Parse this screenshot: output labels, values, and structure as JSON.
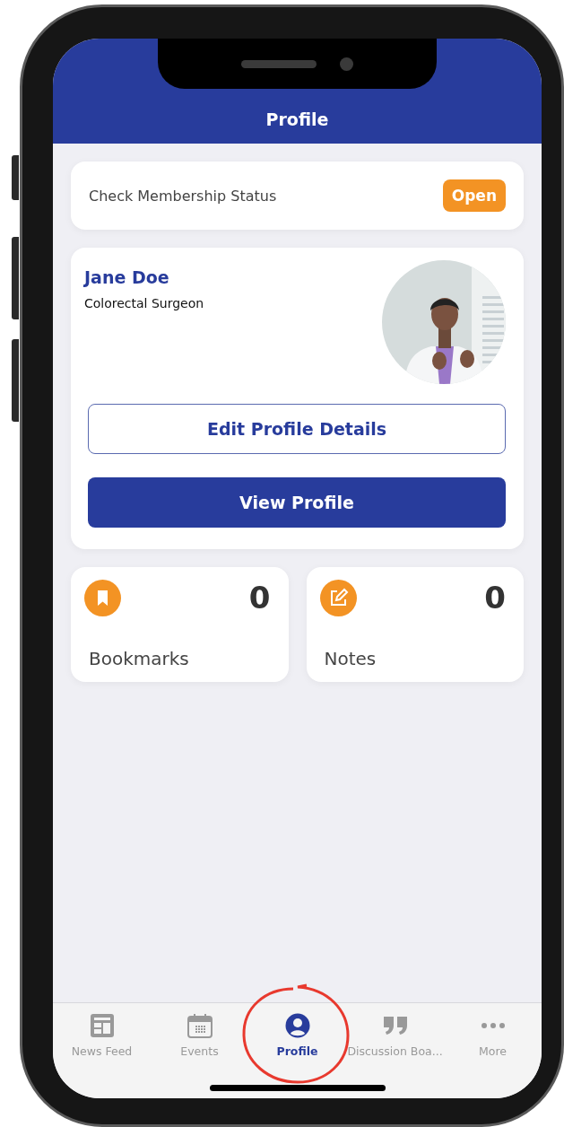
{
  "header": {
    "title": "Profile"
  },
  "membership": {
    "label": "Check Membership Status",
    "button": "Open"
  },
  "profile": {
    "name": "Jane Doe",
    "role": "Colorectal Surgeon",
    "buttons": [
      {
        "label": "Edit Profile Details",
        "kind": "outline"
      },
      {
        "label": "View Profile",
        "kind": "filled"
      }
    ]
  },
  "stats": [
    {
      "kind": "bookmark",
      "count": "0",
      "label": "Bookmarks"
    },
    {
      "kind": "note",
      "count": "0",
      "label": "Notes"
    }
  ],
  "tabs": [
    {
      "kind": "news",
      "label": "News Feed",
      "selected": false
    },
    {
      "kind": "events",
      "label": "Events",
      "selected": false
    },
    {
      "kind": "profile",
      "label": "Profile",
      "selected": true
    },
    {
      "kind": "discussion",
      "label": "Discussion Boa...",
      "selected": false
    },
    {
      "kind": "more",
      "label": "More",
      "selected": false
    }
  ]
}
